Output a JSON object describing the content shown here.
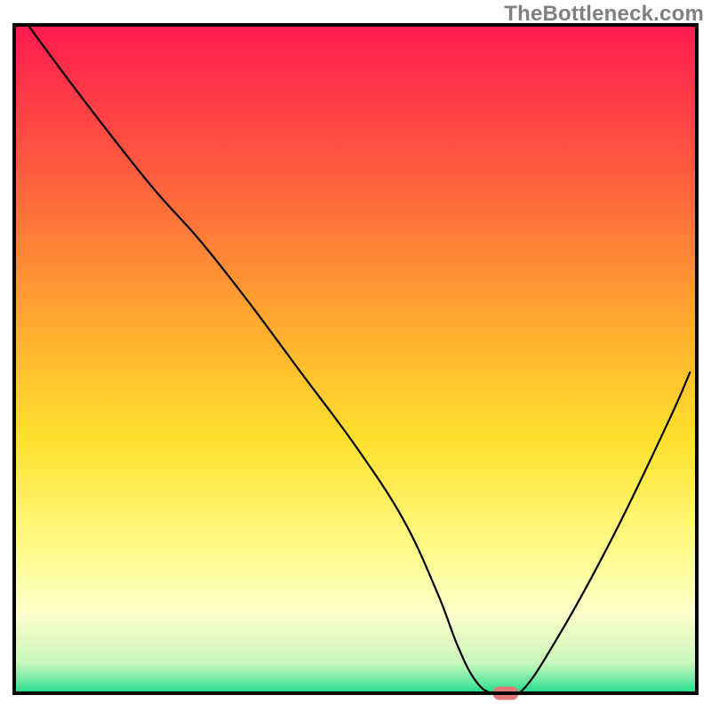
{
  "watermark": "TheBottleneck.com",
  "chart_data": {
    "type": "line",
    "title": "",
    "xlabel": "",
    "ylabel": "",
    "xlim": [
      0,
      100
    ],
    "ylim": [
      0,
      100
    ],
    "grid": false,
    "legend": false,
    "background_gradient": {
      "stops": [
        {
          "offset": 0.0,
          "color": "#ff1a4f"
        },
        {
          "offset": 0.2,
          "color": "#ff5640"
        },
        {
          "offset": 0.45,
          "color": "#ffab2f"
        },
        {
          "offset": 0.62,
          "color": "#ffe12d"
        },
        {
          "offset": 0.78,
          "color": "#fffb86"
        },
        {
          "offset": 0.88,
          "color": "#fdffc9"
        },
        {
          "offset": 0.955,
          "color": "#c9f7bb"
        },
        {
          "offset": 0.985,
          "color": "#5de8a0"
        },
        {
          "offset": 1.0,
          "color": "#1bd885"
        }
      ]
    },
    "series": [
      {
        "name": "bottleneck-curve",
        "x": [
          2.0,
          10,
          20,
          27,
          34,
          42,
          50,
          57,
          62,
          65,
          67.5,
          70,
          74,
          80,
          88,
          96,
          99
        ],
        "y": [
          100,
          89,
          76,
          68,
          59,
          48,
          37,
          26,
          15,
          7,
          2,
          0,
          0,
          9,
          24,
          41,
          48
        ]
      }
    ],
    "marker": {
      "name": "optimal-point",
      "x": 72,
      "y": 0,
      "color": "#e07a78",
      "width": 3.8,
      "height": 2.0
    }
  }
}
